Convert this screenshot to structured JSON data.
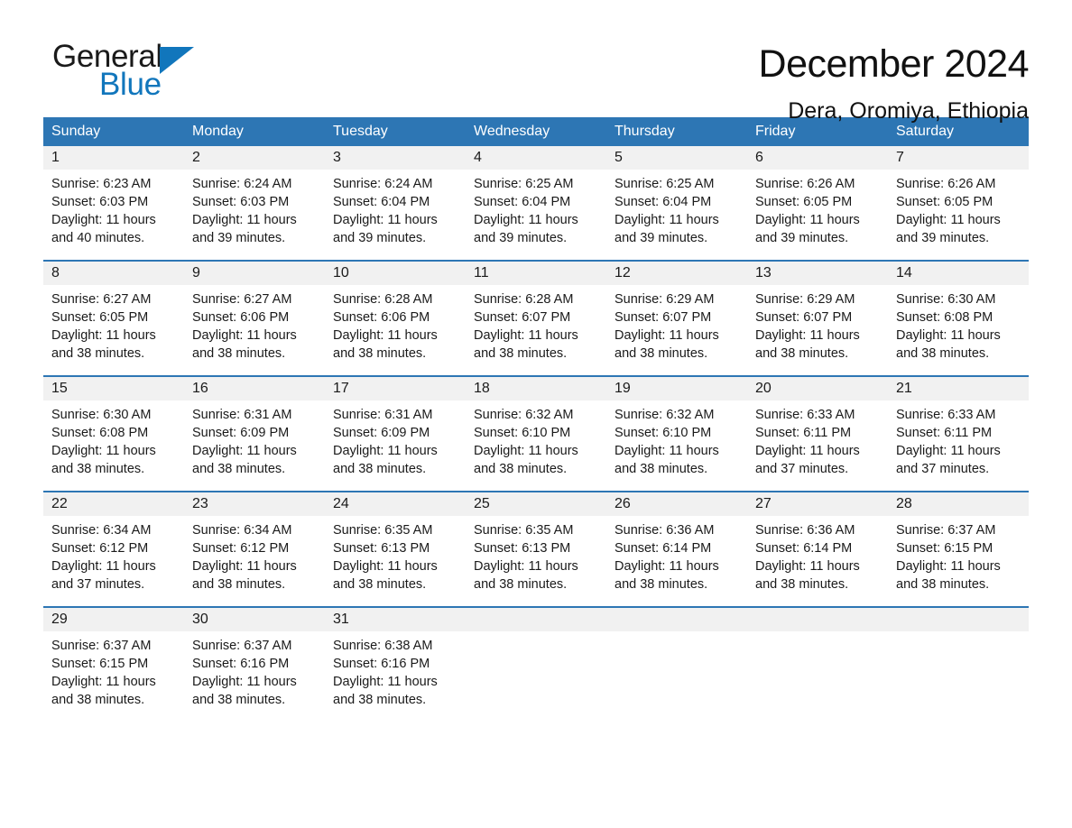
{
  "brand": {
    "name_part1": "General",
    "name_part2": "Blue",
    "triangle_icon": "blue-triangle-icon",
    "accent_color": "#1176bc"
  },
  "header": {
    "title": "December 2024",
    "subtitle": "Dera, Oromiya, Ethiopia"
  },
  "colors": {
    "header_blue": "#2d76b4",
    "day_number_band": "#f1f1f1",
    "text": "#1a1a1a"
  },
  "weekdays": [
    "Sunday",
    "Monday",
    "Tuesday",
    "Wednesday",
    "Thursday",
    "Friday",
    "Saturday"
  ],
  "weeks": [
    [
      {
        "day": "1",
        "sunrise": "Sunrise: 6:23 AM",
        "sunset": "Sunset: 6:03 PM",
        "daylight": "Daylight: 11 hours and 40 minutes."
      },
      {
        "day": "2",
        "sunrise": "Sunrise: 6:24 AM",
        "sunset": "Sunset: 6:03 PM",
        "daylight": "Daylight: 11 hours and 39 minutes."
      },
      {
        "day": "3",
        "sunrise": "Sunrise: 6:24 AM",
        "sunset": "Sunset: 6:04 PM",
        "daylight": "Daylight: 11 hours and 39 minutes."
      },
      {
        "day": "4",
        "sunrise": "Sunrise: 6:25 AM",
        "sunset": "Sunset: 6:04 PM",
        "daylight": "Daylight: 11 hours and 39 minutes."
      },
      {
        "day": "5",
        "sunrise": "Sunrise: 6:25 AM",
        "sunset": "Sunset: 6:04 PM",
        "daylight": "Daylight: 11 hours and 39 minutes."
      },
      {
        "day": "6",
        "sunrise": "Sunrise: 6:26 AM",
        "sunset": "Sunset: 6:05 PM",
        "daylight": "Daylight: 11 hours and 39 minutes."
      },
      {
        "day": "7",
        "sunrise": "Sunrise: 6:26 AM",
        "sunset": "Sunset: 6:05 PM",
        "daylight": "Daylight: 11 hours and 39 minutes."
      }
    ],
    [
      {
        "day": "8",
        "sunrise": "Sunrise: 6:27 AM",
        "sunset": "Sunset: 6:05 PM",
        "daylight": "Daylight: 11 hours and 38 minutes."
      },
      {
        "day": "9",
        "sunrise": "Sunrise: 6:27 AM",
        "sunset": "Sunset: 6:06 PM",
        "daylight": "Daylight: 11 hours and 38 minutes."
      },
      {
        "day": "10",
        "sunrise": "Sunrise: 6:28 AM",
        "sunset": "Sunset: 6:06 PM",
        "daylight": "Daylight: 11 hours and 38 minutes."
      },
      {
        "day": "11",
        "sunrise": "Sunrise: 6:28 AM",
        "sunset": "Sunset: 6:07 PM",
        "daylight": "Daylight: 11 hours and 38 minutes."
      },
      {
        "day": "12",
        "sunrise": "Sunrise: 6:29 AM",
        "sunset": "Sunset: 6:07 PM",
        "daylight": "Daylight: 11 hours and 38 minutes."
      },
      {
        "day": "13",
        "sunrise": "Sunrise: 6:29 AM",
        "sunset": "Sunset: 6:07 PM",
        "daylight": "Daylight: 11 hours and 38 minutes."
      },
      {
        "day": "14",
        "sunrise": "Sunrise: 6:30 AM",
        "sunset": "Sunset: 6:08 PM",
        "daylight": "Daylight: 11 hours and 38 minutes."
      }
    ],
    [
      {
        "day": "15",
        "sunrise": "Sunrise: 6:30 AM",
        "sunset": "Sunset: 6:08 PM",
        "daylight": "Daylight: 11 hours and 38 minutes."
      },
      {
        "day": "16",
        "sunrise": "Sunrise: 6:31 AM",
        "sunset": "Sunset: 6:09 PM",
        "daylight": "Daylight: 11 hours and 38 minutes."
      },
      {
        "day": "17",
        "sunrise": "Sunrise: 6:31 AM",
        "sunset": "Sunset: 6:09 PM",
        "daylight": "Daylight: 11 hours and 38 minutes."
      },
      {
        "day": "18",
        "sunrise": "Sunrise: 6:32 AM",
        "sunset": "Sunset: 6:10 PM",
        "daylight": "Daylight: 11 hours and 38 minutes."
      },
      {
        "day": "19",
        "sunrise": "Sunrise: 6:32 AM",
        "sunset": "Sunset: 6:10 PM",
        "daylight": "Daylight: 11 hours and 38 minutes."
      },
      {
        "day": "20",
        "sunrise": "Sunrise: 6:33 AM",
        "sunset": "Sunset: 6:11 PM",
        "daylight": "Daylight: 11 hours and 37 minutes."
      },
      {
        "day": "21",
        "sunrise": "Sunrise: 6:33 AM",
        "sunset": "Sunset: 6:11 PM",
        "daylight": "Daylight: 11 hours and 37 minutes."
      }
    ],
    [
      {
        "day": "22",
        "sunrise": "Sunrise: 6:34 AM",
        "sunset": "Sunset: 6:12 PM",
        "daylight": "Daylight: 11 hours and 37 minutes."
      },
      {
        "day": "23",
        "sunrise": "Sunrise: 6:34 AM",
        "sunset": "Sunset: 6:12 PM",
        "daylight": "Daylight: 11 hours and 38 minutes."
      },
      {
        "day": "24",
        "sunrise": "Sunrise: 6:35 AM",
        "sunset": "Sunset: 6:13 PM",
        "daylight": "Daylight: 11 hours and 38 minutes."
      },
      {
        "day": "25",
        "sunrise": "Sunrise: 6:35 AM",
        "sunset": "Sunset: 6:13 PM",
        "daylight": "Daylight: 11 hours and 38 minutes."
      },
      {
        "day": "26",
        "sunrise": "Sunrise: 6:36 AM",
        "sunset": "Sunset: 6:14 PM",
        "daylight": "Daylight: 11 hours and 38 minutes."
      },
      {
        "day": "27",
        "sunrise": "Sunrise: 6:36 AM",
        "sunset": "Sunset: 6:14 PM",
        "daylight": "Daylight: 11 hours and 38 minutes."
      },
      {
        "day": "28",
        "sunrise": "Sunrise: 6:37 AM",
        "sunset": "Sunset: 6:15 PM",
        "daylight": "Daylight: 11 hours and 38 minutes."
      }
    ],
    [
      {
        "day": "29",
        "sunrise": "Sunrise: 6:37 AM",
        "sunset": "Sunset: 6:15 PM",
        "daylight": "Daylight: 11 hours and 38 minutes."
      },
      {
        "day": "30",
        "sunrise": "Sunrise: 6:37 AM",
        "sunset": "Sunset: 6:16 PM",
        "daylight": "Daylight: 11 hours and 38 minutes."
      },
      {
        "day": "31",
        "sunrise": "Sunrise: 6:38 AM",
        "sunset": "Sunset: 6:16 PM",
        "daylight": "Daylight: 11 hours and 38 minutes."
      },
      {
        "day": "",
        "sunrise": "",
        "sunset": "",
        "daylight": ""
      },
      {
        "day": "",
        "sunrise": "",
        "sunset": "",
        "daylight": ""
      },
      {
        "day": "",
        "sunrise": "",
        "sunset": "",
        "daylight": ""
      },
      {
        "day": "",
        "sunrise": "",
        "sunset": "",
        "daylight": ""
      }
    ]
  ]
}
